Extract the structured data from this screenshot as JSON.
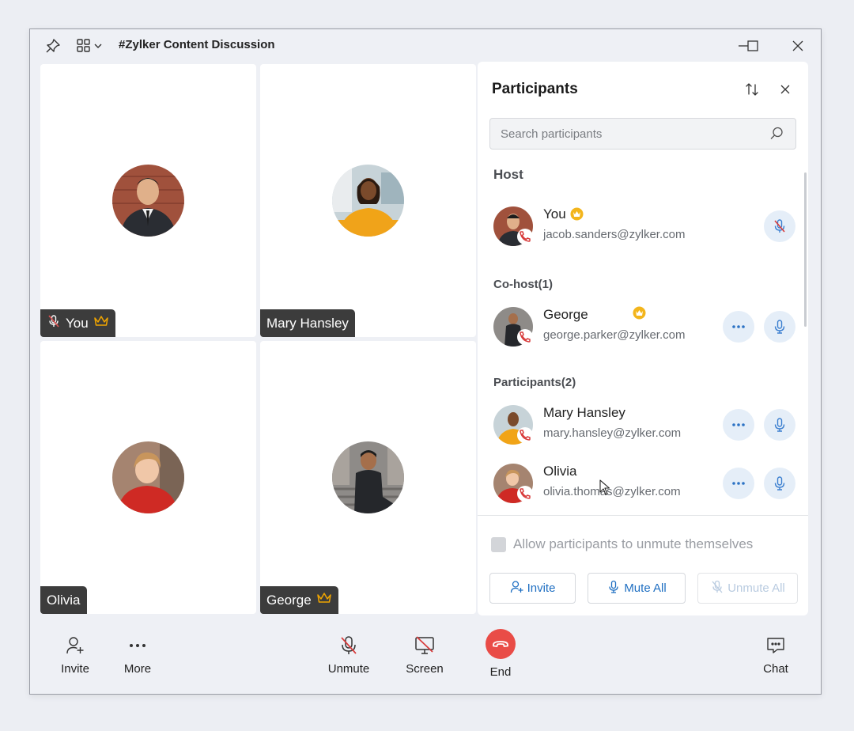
{
  "window": {
    "title": "#Zylker Content Discussion"
  },
  "tiles": [
    {
      "name": "You",
      "muted": true,
      "host": true
    },
    {
      "name": "Mary Hansley",
      "muted": false,
      "host": false
    },
    {
      "name": "Olivia",
      "muted": false,
      "host": false
    },
    {
      "name": "George",
      "muted": false,
      "host": true
    }
  ],
  "panel": {
    "title": "Participants",
    "search_placeholder": "Search participants",
    "host_label": "Host",
    "cohost_label": "Co-host(1)",
    "participants_label": "Participants(2)",
    "host": {
      "name": "You",
      "email": "jacob.sanders@zylker.com"
    },
    "cohosts": [
      {
        "name": "George",
        "email": "george.parker@zylker.com"
      }
    ],
    "participants": [
      {
        "name": "Mary Hansley",
        "email": "mary.hansley@zylker.com"
      },
      {
        "name": "Olivia",
        "email": "olivia.thomas@zylker.com"
      }
    ],
    "allow_unmute_label": "Allow participants to unmute themselves",
    "allow_unmute_checked": false,
    "invite_label": "Invite",
    "mute_all_label": "Mute All",
    "unmute_all_label": "Unmute All"
  },
  "bottombar": {
    "invite_label": "Invite",
    "more_label": "More",
    "unmute_label": "Unmute",
    "screen_label": "Screen",
    "end_label": "End",
    "chat_label": "Chat"
  },
  "colors": {
    "accent": "#1f6fc2",
    "end_red": "#e94c47",
    "crown_gold": "#f0a500",
    "mute_red": "#d83b3b"
  }
}
